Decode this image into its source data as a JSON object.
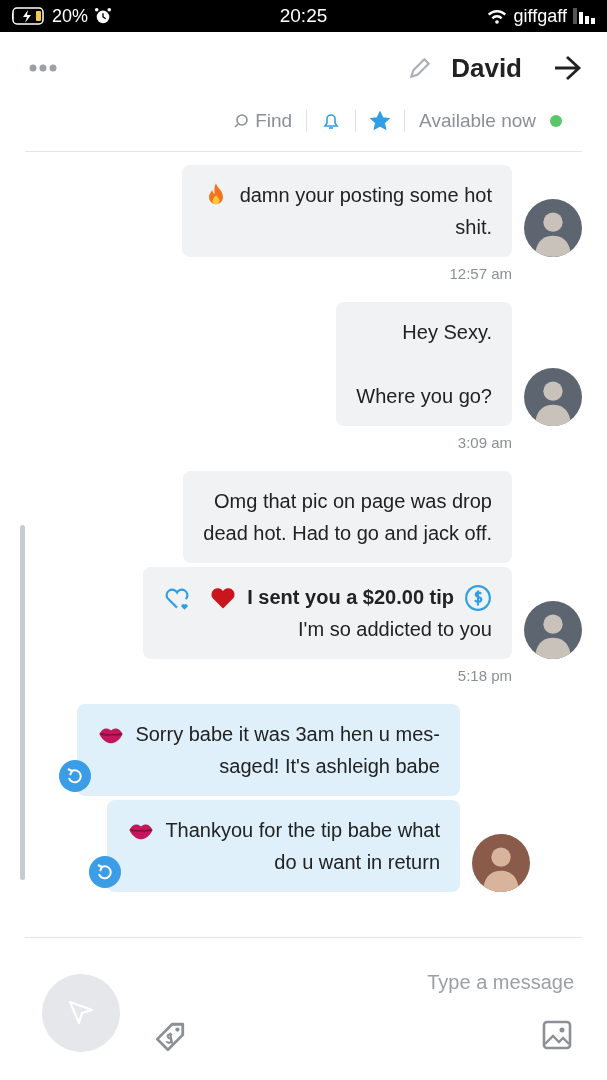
{
  "status_bar": {
    "battery": "20%",
    "time": "20:25",
    "carrier": "giffgaff"
  },
  "header": {
    "name": "David",
    "status": "Available now",
    "online": true,
    "starred": true,
    "find": "Find"
  },
  "messages": [
    {
      "outgoing": false,
      "time": "12:57 am",
      "bubbles": [
        {
          "kind": "text",
          "text": "damn your posting some hot",
          "icon": {
            "kind": "fire"
          },
          "text2": "shit."
        }
      ]
    },
    {
      "outgoing": false,
      "time": "3:09 am",
      "bubbles": [
        {
          "kind": "text",
          "text": "Hey Sexy.\n\nWhere you go?"
        }
      ]
    },
    {
      "outgoing": false,
      "time": "5:18 pm",
      "bubbles": [
        {
          "kind": "text",
          "text": "Omg that pic on page was drop\ndead hot. Had to go and jack off."
        },
        {
          "kind": "tip",
          "tip": "I sent you a $20.00 tip",
          "icon": {
            "kind": "heart"
          },
          "text": "I'm so addicted to you"
        }
      ]
    },
    {
      "outgoing": true,
      "bubbles": [
        {
          "kind": "text",
          "text": "Sorry babe it was 3am hen u mes-\nsaged! It's ashleigh babe",
          "icon": {
            "kind": "kiss"
          }
        },
        {
          "kind": "text",
          "text": "Thankyou for the tip babe what\ndo u want in return",
          "icon": {
            "kind": "kiss"
          }
        }
      ]
    }
  ],
  "composer": {
    "placeholder": "Type a message"
  }
}
